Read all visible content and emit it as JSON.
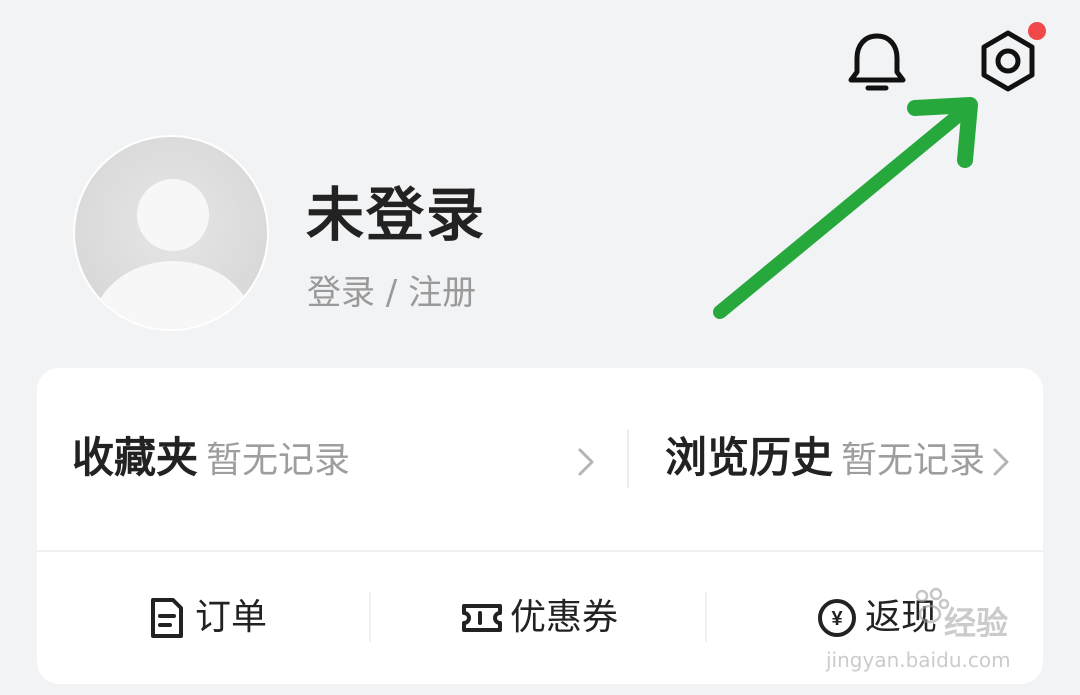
{
  "header": {
    "icons": [
      "bell-icon",
      "settings-hexagon-icon"
    ],
    "settings_badge_color": "#f04848"
  },
  "profile": {
    "username": "未登录",
    "login_link": "登录 / 注册"
  },
  "shortcuts": {
    "favorites": {
      "title": "收藏夹",
      "subtitle": "暂无记录"
    },
    "history": {
      "title": "浏览历史",
      "subtitle": "暂无记录"
    }
  },
  "actions": [
    {
      "label": "订单",
      "icon": "document-icon"
    },
    {
      "label": "优惠券",
      "icon": "ticket-icon"
    },
    {
      "label": "返现",
      "icon": "cashback-icon"
    }
  ],
  "annotation": {
    "arrow_color": "#27a83c"
  },
  "watermark": {
    "main": "经验",
    "sub": "jingyan.baidu.com"
  }
}
